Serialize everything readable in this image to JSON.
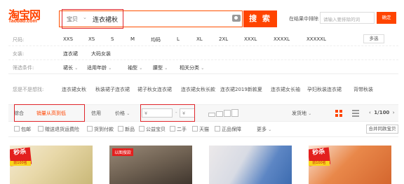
{
  "logo": {
    "cn": "淘宝网",
    "en": "Taobao.com"
  },
  "search": {
    "scope": "宝贝",
    "query": "连衣裙秋",
    "button": "搜 索"
  },
  "within": {
    "label": "在结果中排除",
    "placeholder": "请输入要排除的词",
    "button": "确定"
  },
  "filters": {
    "size": {
      "label": "尺码:",
      "options": [
        "XXS",
        "XS",
        "S",
        "M",
        "均码",
        "L",
        "XL",
        "2XL",
        "XXXL",
        "XXXXL",
        "XXXXXL"
      ],
      "multi": "多选"
    },
    "women": {
      "label": "女装:",
      "options": [
        "连衣裙",
        "大码女装"
      ]
    },
    "conditions": {
      "label": "筛选条件:",
      "options": [
        "裙长",
        "适用年龄",
        "袖型",
        "腰型",
        "相关分类"
      ]
    }
  },
  "guess": {
    "label": "您是不是想找:",
    "items": [
      "连衣裙女秋",
      "秋装裙子连衣裙",
      "裙子秋女连衣裙",
      "连衣裙女秋长款",
      "连衣裙2019新款夏",
      "连衣裙女长袖",
      "孕妇秋装连衣裙",
      "背带秋装"
    ]
  },
  "sort": {
    "general": "综合",
    "sales": "销量从高到低",
    "credit": "信用",
    "price": "价格",
    "min_price": "¥",
    "max_price": "¥",
    "ship_from": "发货地",
    "page": "1/100"
  },
  "checks": [
    "包邮",
    "赠送退货运费险",
    "货到付款",
    "新品",
    "公益宝贝",
    "二手",
    "天猫",
    "正品保障"
  ],
  "more": "更多",
  "fav": "合并同款宝贝",
  "products": [
    {
      "badge": "秒杀",
      "sub": "前100名"
    },
    {
      "tag": "以图搜款"
    },
    {},
    {
      "badge": "秒杀",
      "sub": "前100名"
    }
  ],
  "colors": {
    "accent": "#ff4400",
    "highlight": "#e0252a"
  }
}
